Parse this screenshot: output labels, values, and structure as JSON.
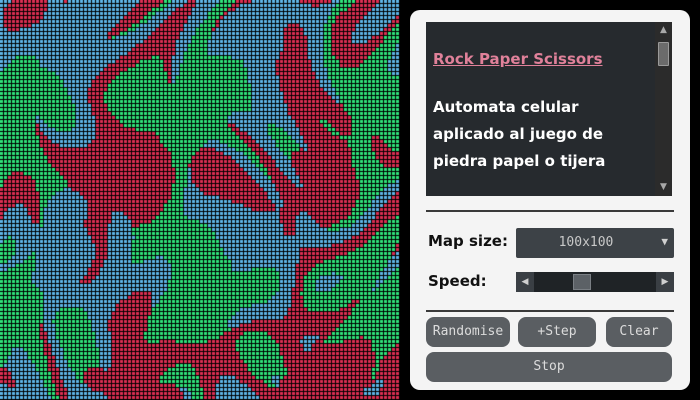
{
  "info": {
    "title": "Rock Paper Scissors",
    "description": "Automata celular aplicado al juego de piedra papel o tijera"
  },
  "controls": {
    "map_size_label": "Map size:",
    "map_size_value": "100x100",
    "speed_label": "Speed:",
    "speed_value": 0.15
  },
  "buttons": {
    "randomise": "Randomise",
    "step": "+Step",
    "clear": "Clear",
    "stop": "Stop"
  },
  "grid": {
    "colors": {
      "rock": "#dc2e52",
      "paper": "#2fe27a",
      "scissors": "#5eb4e6"
    }
  }
}
